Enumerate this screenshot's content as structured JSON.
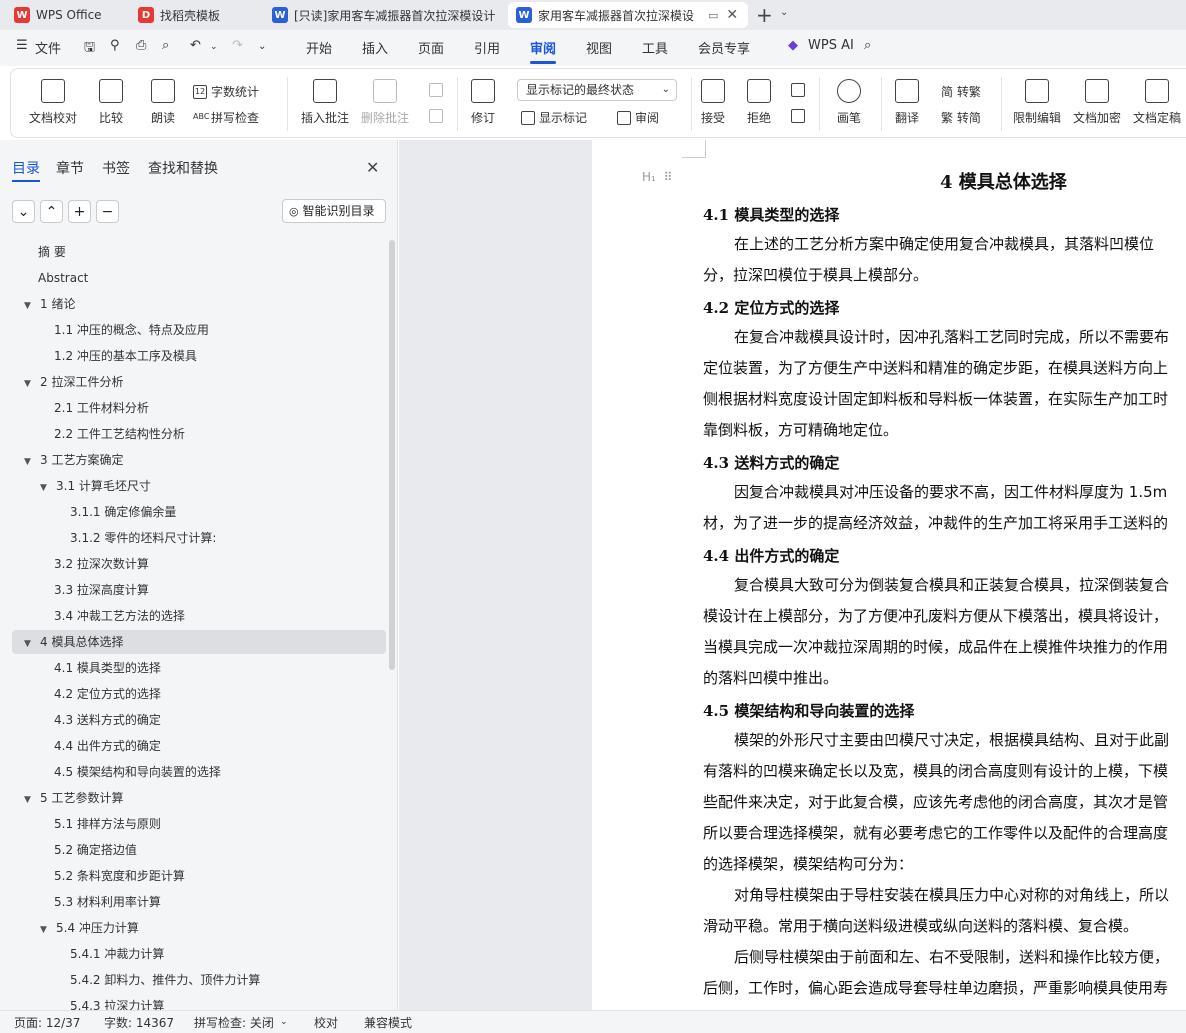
{
  "tabs": [
    {
      "label": "WPS Office",
      "icon": "wps-logo-icon",
      "color": "#e53935"
    },
    {
      "label": "找稻壳模板",
      "icon": "docer-icon",
      "color": "#e53935"
    },
    {
      "label": "[只读]家用客车减振器首次拉深模设计",
      "icon": "word-doc-icon",
      "color": "#2b5fd9"
    },
    {
      "label": "家用客车减振器首次拉深模设",
      "icon": "word-doc-icon",
      "color": "#2b5fd9"
    }
  ],
  "menu": {
    "file": "文件",
    "items": [
      "开始",
      "插入",
      "页面",
      "引用",
      "审阅",
      "视图",
      "工具",
      "会员专享"
    ],
    "active": "审阅",
    "ai": "WPS AI"
  },
  "ribbon": {
    "doc_check": "文档校对",
    "compare": "比较",
    "read_aloud": "朗读",
    "word_count": "字数统计",
    "spell_check": "拼写检查",
    "insert_comment": "插入批注",
    "delete_comment": "删除批注",
    "track": "修订",
    "display_mode": "显示标记的最终状态",
    "show_markup": "显示标记",
    "review_pane": "审阅",
    "accept": "接受",
    "reject": "拒绝",
    "pen": "画笔",
    "translate": "翻译",
    "to_traditional": "简 转繁",
    "to_simplified": "繁 转简",
    "restrict_edit": "限制编辑",
    "encrypt": "文档加密",
    "finalize": "文档定稿"
  },
  "sidebar": {
    "tabs": [
      "目录",
      "章节",
      "书签",
      "查找和替换"
    ],
    "active_tab": "目录",
    "smart_toc": "智能识别目录",
    "toc": [
      {
        "label": "摘  要",
        "level": 0,
        "arrow": ""
      },
      {
        "label": "Abstract",
        "level": 0,
        "arrow": ""
      },
      {
        "label": "1  绪论",
        "level": 1,
        "arrow": "▼"
      },
      {
        "label": "1.1   冲压的概念、特点及应用",
        "level": 2,
        "arrow": ""
      },
      {
        "label": "1.2   冲压的基本工序及模具",
        "level": 2,
        "arrow": ""
      },
      {
        "label": "2  拉深工件分析",
        "level": 1,
        "arrow": "▼"
      },
      {
        "label": "2.1  工件材料分析",
        "level": 2,
        "arrow": ""
      },
      {
        "label": "2.2  工件工艺结构性分析",
        "level": 2,
        "arrow": ""
      },
      {
        "label": "3 工艺方案确定",
        "level": 1,
        "arrow": "▼"
      },
      {
        "label": "3.1  计算毛坯尺寸",
        "level": 2,
        "arrow": "▼"
      },
      {
        "label": "3.1.1 确定修偏余量",
        "level": 3,
        "arrow": ""
      },
      {
        "label": "3.1.2 零件的坯料尺寸计算:",
        "level": 3,
        "arrow": ""
      },
      {
        "label": "3.2  拉深次数计算",
        "level": 2,
        "arrow": ""
      },
      {
        "label": "3.3 拉深高度计算",
        "level": 2,
        "arrow": ""
      },
      {
        "label": "3.4 冲裁工艺方法的选择",
        "level": 2,
        "arrow": ""
      },
      {
        "label": "4  模具总体选择",
        "level": 1,
        "arrow": "▼"
      },
      {
        "label": "4.1  模具类型的选择",
        "level": 2,
        "arrow": ""
      },
      {
        "label": "4.2  定位方式的选择",
        "level": 2,
        "arrow": ""
      },
      {
        "label": "4.3  送料方式的确定",
        "level": 2,
        "arrow": ""
      },
      {
        "label": "4.4  出件方式的确定",
        "level": 2,
        "arrow": ""
      },
      {
        "label": "4.5 模架结构和导向装置的选择",
        "level": 2,
        "arrow": ""
      },
      {
        "label": "5  工艺参数计算",
        "level": 1,
        "arrow": "▼"
      },
      {
        "label": "5.1 排样方法与原则",
        "level": 2,
        "arrow": ""
      },
      {
        "label": "5.2  确定搭边值",
        "level": 2,
        "arrow": ""
      },
      {
        "label": "5.2  条料宽度和步距计算",
        "level": 2,
        "arrow": ""
      },
      {
        "label": "5.3  材料利用率计算",
        "level": 2,
        "arrow": ""
      },
      {
        "label": "5.4  冲压力计算",
        "level": 2,
        "arrow": "▼"
      },
      {
        "label": "5.4.1 冲裁力计算",
        "level": 3,
        "arrow": ""
      },
      {
        "label": "5.4.2 卸料力、推件力、顶件力计算",
        "level": 3,
        "arrow": ""
      },
      {
        "label": "5.4.3 拉深力计算",
        "level": 3,
        "arrow": ""
      }
    ],
    "selected_index": 15
  },
  "document": {
    "h1": "4  模具总体选择",
    "heading_marker": "H₁",
    "blocks": [
      {
        "type": "h2",
        "text": "4.1  模具类型的选择"
      },
      {
        "type": "p",
        "lines": [
          "在上述的工艺分析方案中确定使用复合冲裁模具，其落料凹模位",
          "分，拉深凹模位于模具上模部分。"
        ]
      },
      {
        "type": "h2",
        "text": "4.2  定位方式的选择"
      },
      {
        "type": "p",
        "lines": [
          "在复合冲裁模具设计时，因冲孔落料工艺同时完成，所以不需要布",
          "定位装置，为了方便生产中送料和精准的确定步距，在模具送料方向上",
          "侧根据材料宽度设计固定卸料板和导料板一体装置，在实际生产加工时",
          "靠倒料板，方可精确地定位。"
        ]
      },
      {
        "type": "h2",
        "text": "4.3  送料方式的确定"
      },
      {
        "type": "p",
        "lines": [
          "因复合冲裁模具对冲压设备的要求不高，因工件材料厚度为 1.5m",
          "材，为了进一步的提高经济效益，冲裁件的生产加工将采用手工送料的"
        ]
      },
      {
        "type": "h2",
        "text": "4.4  出件方式的确定"
      },
      {
        "type": "p",
        "lines": [
          "复合模具大致可分为倒装复合模具和正装复合模具，拉深倒装复合",
          "模设计在上模部分，为了方便冲孔废料方便从下模落出，模具将设计，",
          "当模具完成一次冲裁拉深周期的时候，成品件在上模推件块推力的作用",
          "的落料凹模中推出。"
        ]
      },
      {
        "type": "h2",
        "text": "4.5 模架结构和导向装置的选择"
      },
      {
        "type": "p",
        "lines": [
          "模架的外形尺寸主要由凹模尺寸决定，根据模具结构、且对于此副",
          "有落料的凹模来确定长以及宽，模具的闭合高度则有设计的上模，下模",
          "些配件来决定，对于此复合模，应该先考虑他的闭合高度，其次才是管",
          "所以要合理选择模架，就有必要考虑它的工作零件以及配件的合理高度",
          "的选择模架，模架结构可分为："
        ]
      },
      {
        "type": "p",
        "lines": [
          "对角导柱模架由于导柱安装在模具压力中心对称的对角线上，所以",
          "滑动平稳。常用于横向送料级进模或纵向送料的落料模、复合模。"
        ]
      },
      {
        "type": "p",
        "lines": [
          "后侧导柱模架由于前面和左、右不受限制，送料和操作比较方便，",
          "后侧，工作时，偏心距会造成导套导柱单边磨损，严重影响模具使用寿"
        ]
      }
    ]
  },
  "status": {
    "page": "页面: 12/37",
    "words": "字数: 14367",
    "spell": "拼写检查: 关闭",
    "proof": "校对",
    "compat": "兼容模式"
  }
}
